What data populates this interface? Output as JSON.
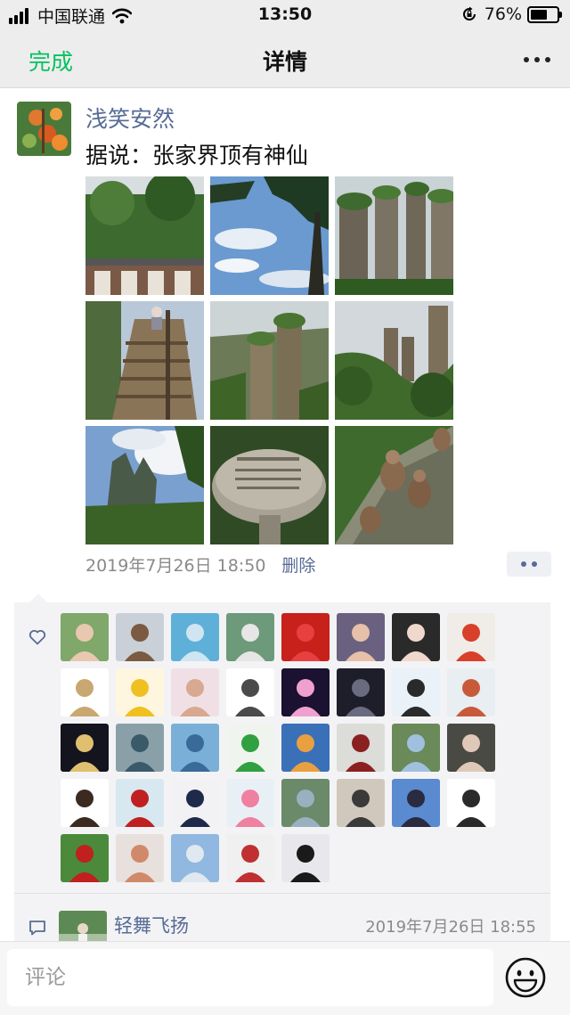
{
  "status_bar": {
    "carrier": "中国联通",
    "time": "13:50",
    "battery_text": "76%",
    "battery_level": 0.76
  },
  "nav": {
    "done_label": "完成",
    "title": "详情",
    "more_icon": "more-dots-icon"
  },
  "post": {
    "author": "浅笑安然",
    "text": "据说：张家界顶有神仙",
    "timestamp": "2019年7月26日 18:50",
    "delete_label": "删除",
    "photos": [
      {
        "name": "building-forest"
      },
      {
        "name": "pine-sky"
      },
      {
        "name": "cliff-pillars"
      },
      {
        "name": "wooden-stairs"
      },
      {
        "name": "mountain-valley"
      },
      {
        "name": "green-peaks"
      },
      {
        "name": "rock-clouds"
      },
      {
        "name": "engraved-stone"
      },
      {
        "name": "monkeys"
      }
    ]
  },
  "likes": {
    "icon": "heart-outline-icon",
    "count": 37
  },
  "comment": {
    "icon": "comment-bubble-icon",
    "author": "轻舞飞扬",
    "time": "2019年7月26日 18:55"
  },
  "input": {
    "placeholder": "评论",
    "emoji_icon": "smiley-icon"
  },
  "colors": {
    "accent_green": "#07c160",
    "link_blue": "#576b95"
  }
}
